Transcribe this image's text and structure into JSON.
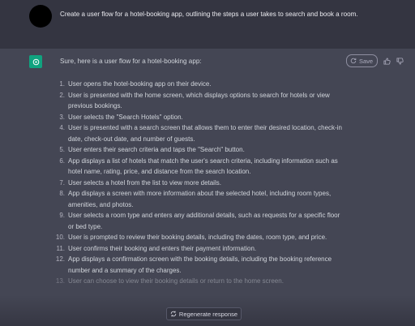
{
  "user_message": {
    "text": "Create a user flow for a hotel-booking app, outlining the steps a user takes to search and book a room."
  },
  "assistant_message": {
    "intro": "Sure, here is a user flow for a hotel-booking app:",
    "save_label": "Save",
    "steps": [
      {
        "num": "1.",
        "text": "User opens the hotel-booking app on their device."
      },
      {
        "num": "2.",
        "text": "User is presented with the home screen, which displays options to search for hotels or view previous bookings."
      },
      {
        "num": "3.",
        "text": "User selects the \"Search Hotels\" option."
      },
      {
        "num": "4.",
        "text": "User is presented with a search screen that allows them to enter their desired location, check-in date, check-out date, and number of guests."
      },
      {
        "num": "5.",
        "text": "User enters their search criteria and taps the \"Search\" button."
      },
      {
        "num": "6.",
        "text": "App displays a list of hotels that match the user's search criteria, including information such as hotel name, rating, price, and distance from the search location."
      },
      {
        "num": "7.",
        "text": "User selects a hotel from the list to view more details."
      },
      {
        "num": "8.",
        "text": "App displays a screen with more information about the selected hotel, including room types, amenities, and photos."
      },
      {
        "num": "9.",
        "text": "User selects a room type and enters any additional details, such as requests for a specific floor or bed type."
      },
      {
        "num": "10.",
        "text": "User is prompted to review their booking details, including the dates, room type, and price."
      },
      {
        "num": "11.",
        "text": "User confirms their booking and enters their payment information."
      },
      {
        "num": "12.",
        "text": "App displays a confirmation screen with the booking details, including the booking reference number and a summary of the charges."
      },
      {
        "num": "13.",
        "text": "User can choose to view their booking details or return to the home screen."
      }
    ]
  },
  "regenerate_label": "Regenerate response",
  "colors": {
    "accent": "#10a37f",
    "background": "#343541",
    "assistant_background": "#444654"
  }
}
